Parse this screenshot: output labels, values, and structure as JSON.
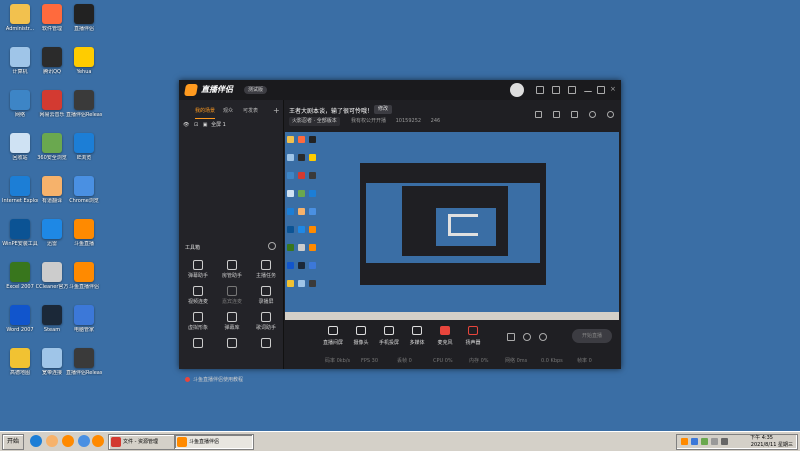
{
  "desktop": {
    "icons": [
      {
        "label": "Administr...",
        "color": "#f2c14e"
      },
      {
        "label": "软件管理",
        "color": "#ff6a3d"
      },
      {
        "label": "直播伴侣",
        "color": "#222222"
      },
      {
        "label": "计算机",
        "color": "#9fc5e8"
      },
      {
        "label": "腾讯QQ",
        "color": "#2b2b2b"
      },
      {
        "label": "Yehua",
        "color": "#ffcc00"
      },
      {
        "label": "网络",
        "color": "#3d85c6"
      },
      {
        "label": "网易云音乐",
        "color": "#d33a31"
      },
      {
        "label": "直播伴侣Release",
        "color": "#3a3a3a"
      },
      {
        "label": "回收站",
        "color": "#cfe2f3"
      },
      {
        "label": "360安全浏览",
        "color": "#6aa84f"
      },
      {
        "label": "IE浏览",
        "color": "#1c7ed6"
      },
      {
        "label": "Internet Explorer",
        "color": "#1c7ed6"
      },
      {
        "label": "有道翻译",
        "color": "#f6b26b"
      },
      {
        "label": "Chrome浏览",
        "color": "#4a90e2"
      },
      {
        "label": "WinPE安装工具",
        "color": "#0b5394"
      },
      {
        "label": "迅雷",
        "color": "#1e88e5"
      },
      {
        "label": "斗鱼直播",
        "color": "#ff8a00"
      },
      {
        "label": "Excel 2007",
        "color": "#38761d"
      },
      {
        "label": "CCleaner官方",
        "color": "#cccccc"
      },
      {
        "label": "斗鱼直播伴侣",
        "color": "#ff8a00"
      },
      {
        "label": "Word 2007",
        "color": "#1155cc"
      },
      {
        "label": "Steam",
        "color": "#1b2838"
      },
      {
        "label": "电脑管家",
        "color": "#3c78d8"
      },
      {
        "label": "高德地图",
        "color": "#f1c232"
      },
      {
        "label": "宽带连接",
        "color": "#9fc5e8"
      },
      {
        "label": "直播伴侣Release",
        "color": "#3a3a3a"
      }
    ]
  },
  "taskbar": {
    "start_label": "开始",
    "tasks": [
      {
        "label": "文件 - 资源管理",
        "color": "#d33a31"
      },
      {
        "label": "斗鱼直播伴侣",
        "color": "#ff8a00"
      }
    ],
    "clock_time": "下午 4:35",
    "clock_date": "2021/8/11 星期三"
  },
  "app": {
    "name": "直播伴侣",
    "version": "测试版",
    "tabs": [
      "我的场景",
      "观众",
      "可发表"
    ],
    "add_tab": "+",
    "scene_label": "全屏 1",
    "room_title": "王者大剧本谈，输了很可怜哦！",
    "edit_button": "修改",
    "room_category": "火影忍者 · 全部版本",
    "room_meta": [
      "我有权公开开播",
      "10159252",
      "246"
    ],
    "tools_title": "工具箱",
    "tools": [
      {
        "label": "弹幕助手",
        "dim": false
      },
      {
        "label": "房管助手",
        "dim": false
      },
      {
        "label": "主播任务",
        "dim": false
      },
      {
        "label": "视频连麦",
        "dim": false
      },
      {
        "label": "嘉宾连麦",
        "dim": true
      },
      {
        "label": "录播屏",
        "dim": false
      },
      {
        "label": "虚拟形象",
        "dim": false
      },
      {
        "label": "弹幕库",
        "dim": false
      },
      {
        "label": "歌词助手",
        "dim": false
      },
      {
        "label": "",
        "dim": false
      },
      {
        "label": "",
        "dim": false
      },
      {
        "label": "",
        "dim": false
      }
    ],
    "notice": "斗鱼直播伴侣使用教程",
    "toolbar": [
      {
        "label": "直播间屏",
        "icon": "screen-share-icon"
      },
      {
        "label": "摄像头",
        "icon": "camera-icon"
      },
      {
        "label": "手机投屏",
        "icon": "phone-cast-icon"
      },
      {
        "label": "多媒体",
        "icon": "media-icon"
      },
      {
        "label": "麦克风",
        "icon": "microphone-icon"
      },
      {
        "label": "扬声器",
        "icon": "speaker-icon"
      }
    ],
    "start_button": "开始直播",
    "status": [
      "码率 0kb/s",
      "FPS 30",
      "丢帧 0",
      "CPU 0%",
      "内存 0%",
      "网络 0ms",
      "0.0 Kbps",
      "帧率 0"
    ]
  }
}
